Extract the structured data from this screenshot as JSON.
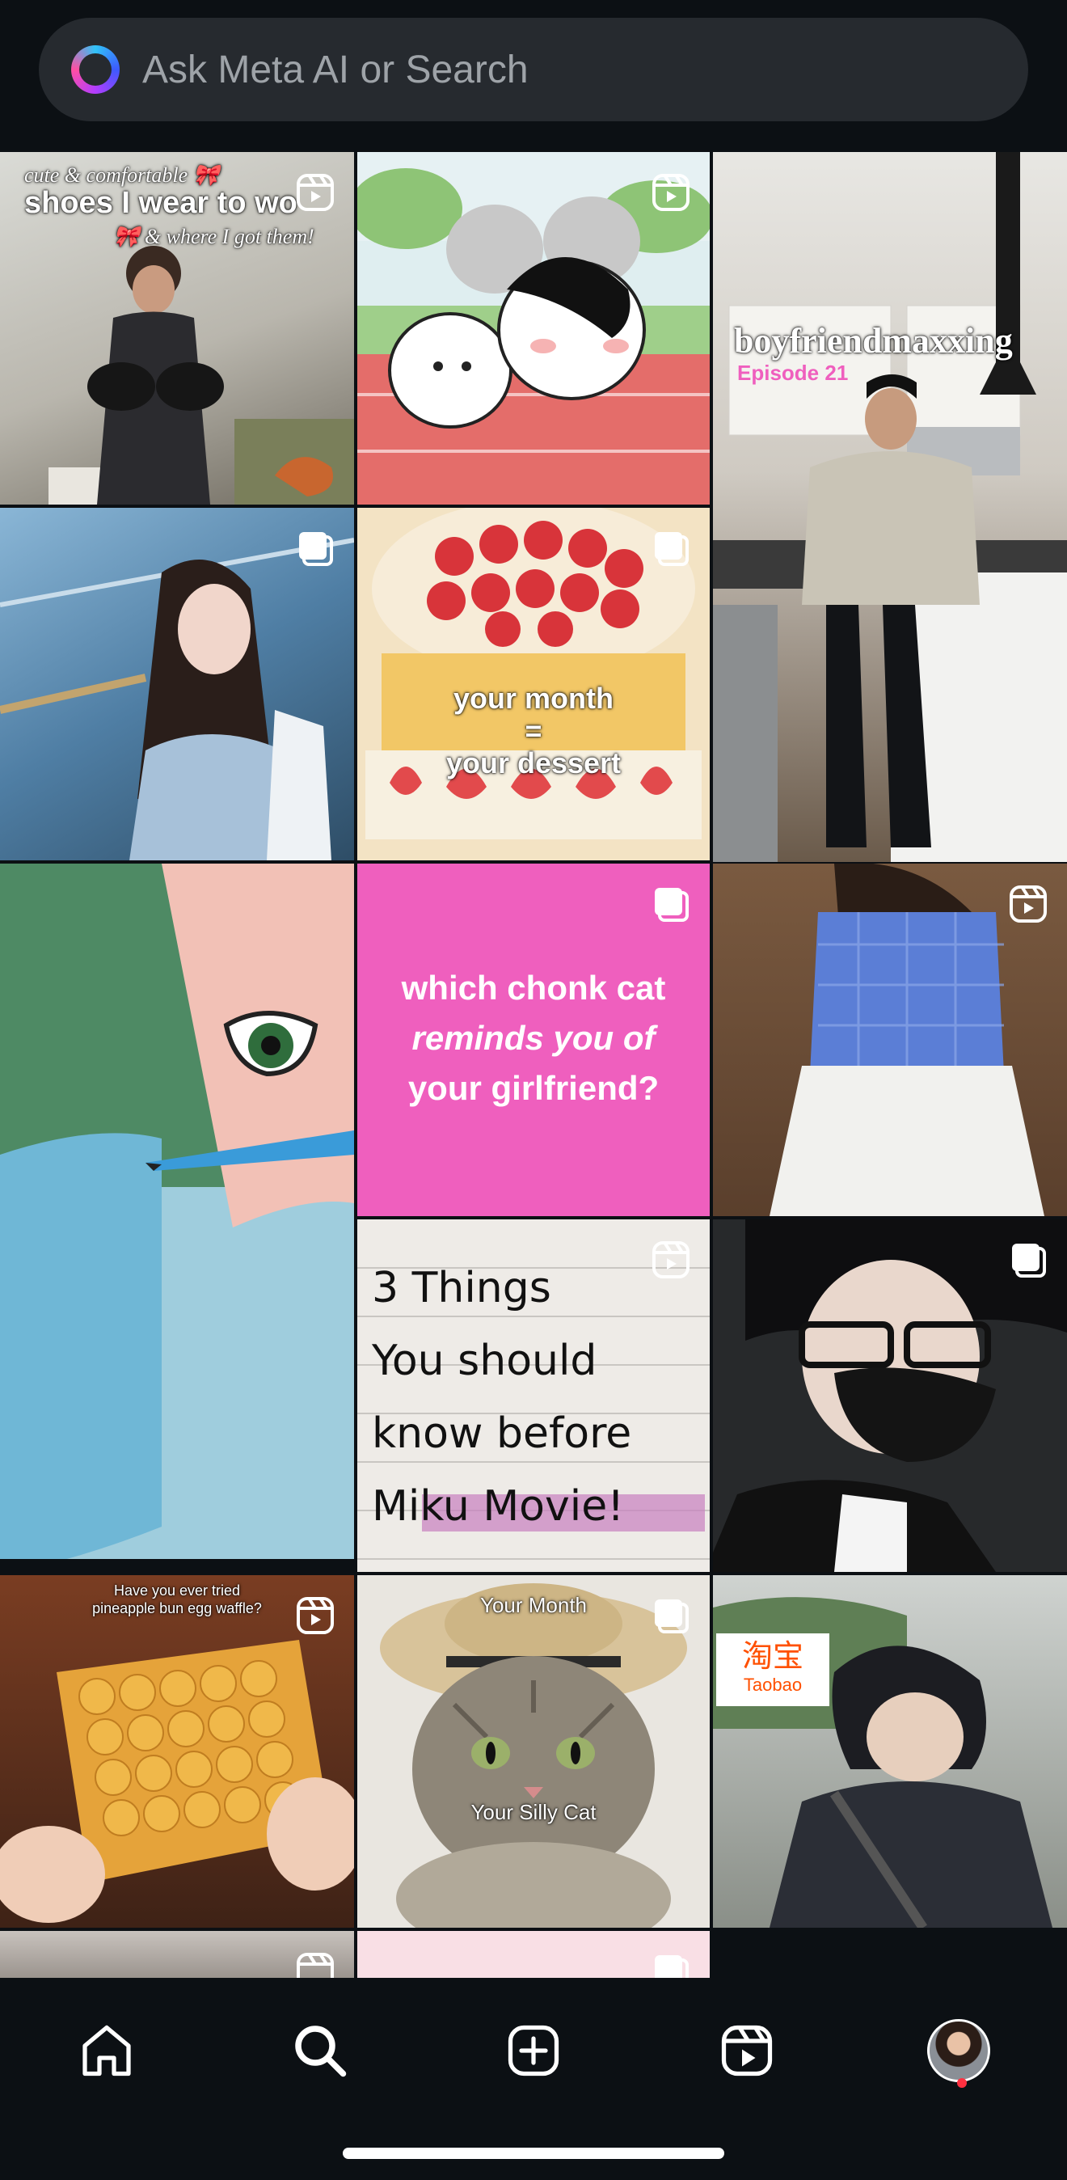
{
  "search": {
    "placeholder": "Ask Meta AI or Search",
    "icon": "meta-ai-ring-icon"
  },
  "grid": {
    "tiles": [
      {
        "type": "reel",
        "caption_top": "cute & comfortable 🎀",
        "caption_main": "shoes I wear to wo",
        "caption_sub": "🎀 & where I got them!"
      },
      {
        "type": "reel",
        "caption_main": ""
      },
      {
        "type": "reel",
        "caption_main": "boyfriendmaxxing",
        "caption_sub": "Episode 21"
      },
      {
        "type": "carousel",
        "caption_main": ""
      },
      {
        "type": "carousel",
        "caption_main": "your month\n=\nyour dessert"
      },
      {
        "type": "reel",
        "caption_main": ""
      },
      {
        "type": "carousel",
        "caption_main": "which chonk cat",
        "caption_em": "reminds you of",
        "caption_sub": "your girlfriend?"
      },
      {
        "type": "reel",
        "caption_main": ""
      },
      {
        "type": "reel",
        "caption_main": "3 Things\nYou should\nknow before\nMiku Movie!"
      },
      {
        "type": "carousel",
        "caption_main": ""
      },
      {
        "type": "reel",
        "caption_main": "Have you ever tried\npineapple bun egg waffle?"
      },
      {
        "type": "carousel",
        "caption_top": "Your Month",
        "caption_main": "Your Silly Cat"
      },
      {
        "type": "reel",
        "brand_cn": "淘宝",
        "brand_en": "Taobao"
      }
    ]
  },
  "tabbar": {
    "items": [
      "home-icon",
      "search-icon",
      "create-icon",
      "reels-icon",
      "profile-avatar"
    ]
  },
  "colors": {
    "background": "#0c1014",
    "search_bg": "#262a2f",
    "accent_pink": "#ef5fbe",
    "notif": "#ff3040"
  }
}
